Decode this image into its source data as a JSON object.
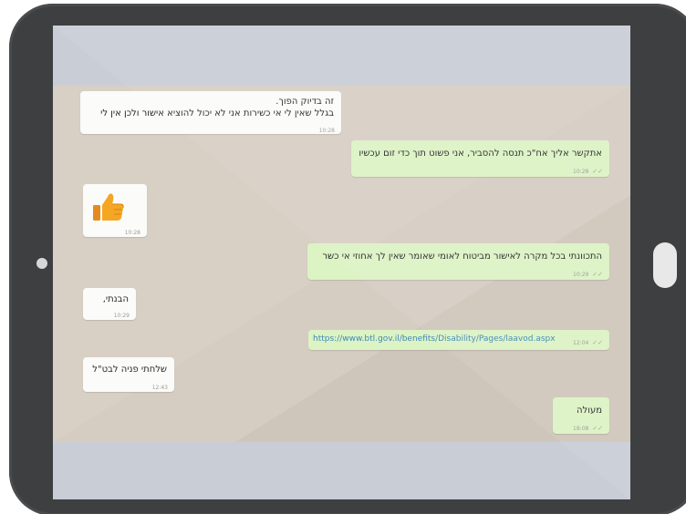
{
  "colors": {
    "tablet_frame": "#3e3f41",
    "chat_background": "#d6cdc2",
    "incoming_bubble": "#fbfbf9",
    "outgoing_bubble": "#dcf3c4",
    "link": "#3f87b6"
  },
  "messages": [
    {
      "direction": "incoming",
      "lines": [
        "זה בדיוק הפוך.",
        "בגלל שאין לי אי כשירות אני לא יכול להוציא אישור ולכן אין לי"
      ],
      "time": "10:28"
    },
    {
      "direction": "outgoing",
      "text": "אתקשר אליך אח\"כ תנסה להסביר, אני פשוט תוך כדי זום עכשיו",
      "time": "10:28",
      "status": "read"
    },
    {
      "direction": "incoming",
      "icon": "thumbs-up-icon",
      "time": "10:28"
    },
    {
      "direction": "outgoing",
      "text": "התכוונתי בכל מקרה לאישור מביטוח לאומי שאומר שאין לך אחוזי אי כשר",
      "time": "10:29",
      "status": "read"
    },
    {
      "direction": "incoming",
      "text": "הבנתי,",
      "time": "10:29"
    },
    {
      "direction": "outgoing",
      "link": "https://www.btl.gov.il/benefits/Disability/Pages/laavod.aspx",
      "time": "12:04",
      "status": "read"
    },
    {
      "direction": "incoming",
      "text": "שלחתי פניה לבט\"ל",
      "time": "12:43"
    },
    {
      "direction": "outgoing",
      "text": "מעולה",
      "time": "18:08",
      "status": "read"
    }
  ]
}
